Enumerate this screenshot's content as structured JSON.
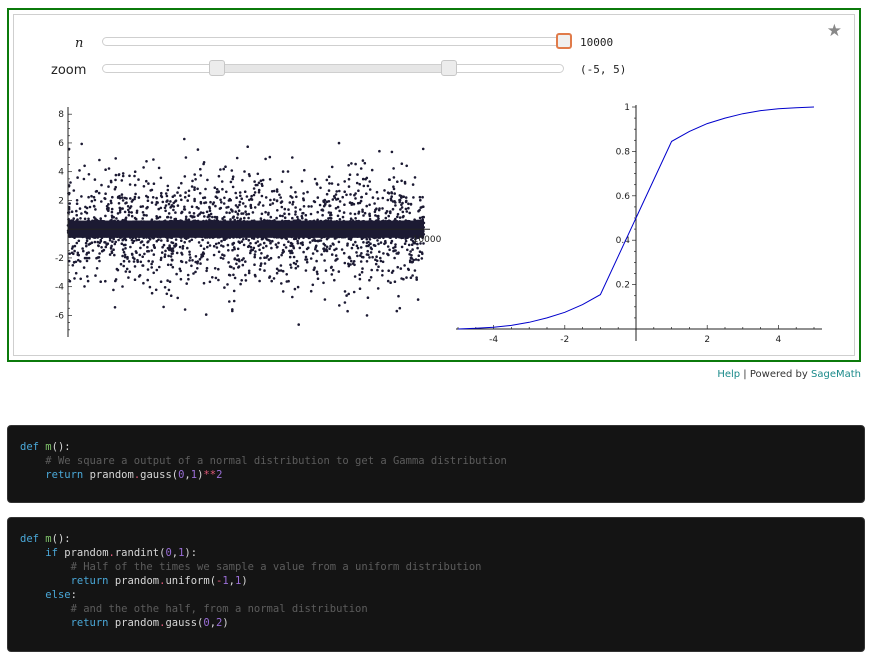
{
  "controls": {
    "n_label": "n",
    "n_value": "10000",
    "zoom_label": "zoom",
    "zoom_value": "(-5, 5)"
  },
  "chart_data": [
    {
      "type": "scatter",
      "xlim": [
        0,
        10000
      ],
      "ylim": [
        -7.5,
        8.5
      ],
      "yticks": [
        -6,
        -4,
        -2,
        2,
        4,
        6,
        8
      ],
      "xticks": [
        10000
      ],
      "ytick_labels": [
        "-6",
        "-4",
        "-2",
        "2",
        "4",
        "6",
        "8"
      ],
      "xtick_labels": [
        "10000"
      ],
      "n_points": 10000,
      "dense_band": [
        -0.6,
        0.6
      ],
      "spread": [
        -7.5,
        8.5
      ]
    },
    {
      "type": "line",
      "xlim": [
        -5,
        5
      ],
      "ylim": [
        0,
        1
      ],
      "xticks": [
        -4,
        -2,
        2,
        4
      ],
      "yticks": [
        0.2,
        0.4,
        0.6,
        0.8,
        1
      ],
      "xtick_labels": [
        "-4",
        "-2",
        "2",
        "4"
      ],
      "ytick_labels": [
        "0.2",
        "0.4",
        "0.6",
        "0.8",
        "1"
      ],
      "color": "#0000cc",
      "x": [
        -5,
        -4.5,
        -4,
        -3.5,
        -3,
        -2.5,
        -2,
        -1.5,
        -1,
        0,
        1,
        1.5,
        2,
        2.5,
        3,
        3.5,
        4,
        4.5,
        5
      ],
      "y": [
        0.0,
        0.003,
        0.008,
        0.016,
        0.03,
        0.05,
        0.075,
        0.11,
        0.155,
        0.5,
        0.845,
        0.89,
        0.925,
        0.95,
        0.97,
        0.984,
        0.992,
        0.997,
        1.0
      ]
    }
  ],
  "footer": {
    "help": "Help",
    "sep": " | Powered by ",
    "sagemath": "SageMath"
  },
  "code_blocks": [
    {
      "lines": [
        [
          {
            "c": "kw",
            "t": "def "
          },
          {
            "c": "fn",
            "t": "m"
          },
          {
            "c": "",
            "t": "():"
          }
        ],
        [
          {
            "c": "",
            "t": "    "
          },
          {
            "c": "cm",
            "t": "# We square a output of a normal distribution to get a Gamma distribution"
          }
        ],
        [
          {
            "c": "",
            "t": "    "
          },
          {
            "c": "kw",
            "t": "return "
          },
          {
            "c": "",
            "t": "prandom"
          },
          {
            "c": "op",
            "t": "."
          },
          {
            "c": "",
            "t": "gauss("
          },
          {
            "c": "num",
            "t": "0"
          },
          {
            "c": "",
            "t": ","
          },
          {
            "c": "num",
            "t": "1"
          },
          {
            "c": "",
            "t": ")"
          },
          {
            "c": "op",
            "t": "**"
          },
          {
            "c": "num",
            "t": "2"
          }
        ]
      ]
    },
    {
      "lines": [
        [
          {
            "c": "kw",
            "t": "def "
          },
          {
            "c": "fn",
            "t": "m"
          },
          {
            "c": "",
            "t": "():"
          }
        ],
        [
          {
            "c": "",
            "t": "    "
          },
          {
            "c": "kw",
            "t": "if "
          },
          {
            "c": "",
            "t": "prandom"
          },
          {
            "c": "op",
            "t": "."
          },
          {
            "c": "",
            "t": "randint("
          },
          {
            "c": "num",
            "t": "0"
          },
          {
            "c": "",
            "t": ","
          },
          {
            "c": "num",
            "t": "1"
          },
          {
            "c": "",
            "t": "):"
          }
        ],
        [
          {
            "c": "",
            "t": "        "
          },
          {
            "c": "cm",
            "t": "# Half of the times we sample a value from a uniform distribution"
          }
        ],
        [
          {
            "c": "",
            "t": "        "
          },
          {
            "c": "kw",
            "t": "return "
          },
          {
            "c": "",
            "t": "prandom"
          },
          {
            "c": "op",
            "t": "."
          },
          {
            "c": "",
            "t": "uniform("
          },
          {
            "c": "op",
            "t": "-"
          },
          {
            "c": "num",
            "t": "1"
          },
          {
            "c": "",
            "t": ","
          },
          {
            "c": "num",
            "t": "1"
          },
          {
            "c": "",
            "t": ")"
          }
        ],
        [
          {
            "c": "",
            "t": "    "
          },
          {
            "c": "kw",
            "t": "else"
          },
          {
            "c": "",
            "t": ":"
          }
        ],
        [
          {
            "c": "",
            "t": "        "
          },
          {
            "c": "cm",
            "t": "# and the othe half, from a normal distribution"
          }
        ],
        [
          {
            "c": "",
            "t": "        "
          },
          {
            "c": "kw",
            "t": "return "
          },
          {
            "c": "",
            "t": "prandom"
          },
          {
            "c": "op",
            "t": "."
          },
          {
            "c": "",
            "t": "gauss("
          },
          {
            "c": "num",
            "t": "0"
          },
          {
            "c": "",
            "t": ","
          },
          {
            "c": "num",
            "t": "2"
          },
          {
            "c": "",
            "t": ")"
          }
        ]
      ]
    }
  ]
}
